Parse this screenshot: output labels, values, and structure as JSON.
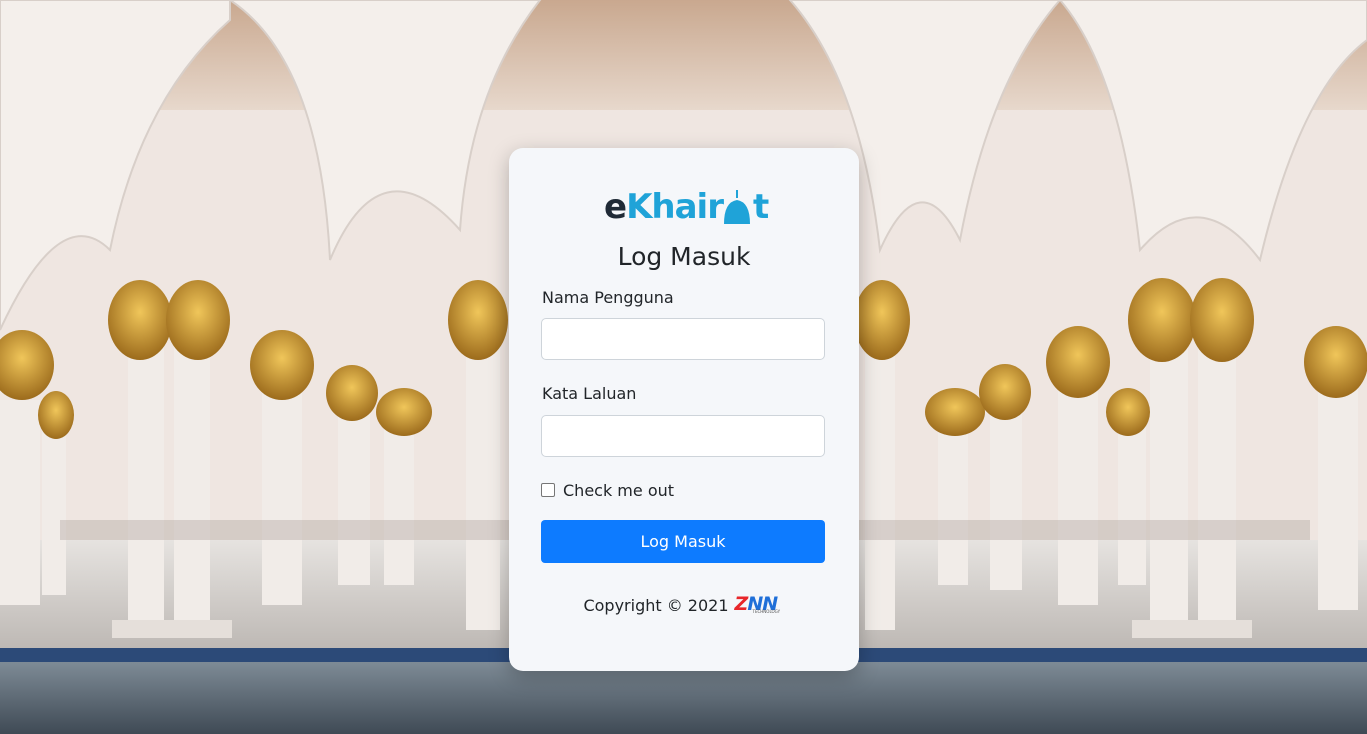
{
  "brand": {
    "logo_prefix": "e",
    "logo_main": "Khair",
    "logo_suffix": "t",
    "primary_color": "#1fa3d8",
    "dark_color": "#1f2a36"
  },
  "form": {
    "title": "Log Masuk",
    "username_label": "Nama Pengguna",
    "username_value": "",
    "password_label": "Kata Laluan",
    "password_value": "",
    "checkbox_label": "Check me out",
    "checkbox_checked": false,
    "submit_label": "Log Masuk",
    "submit_color": "#0d7bff"
  },
  "footer": {
    "copyright": "Copyright © 2021",
    "company_logo_z": "Z",
    "company_logo_nn": "NN",
    "company_logo_sub": "TECHNOLOGY"
  },
  "background": {
    "description_icon": "mosque-arches-background"
  }
}
